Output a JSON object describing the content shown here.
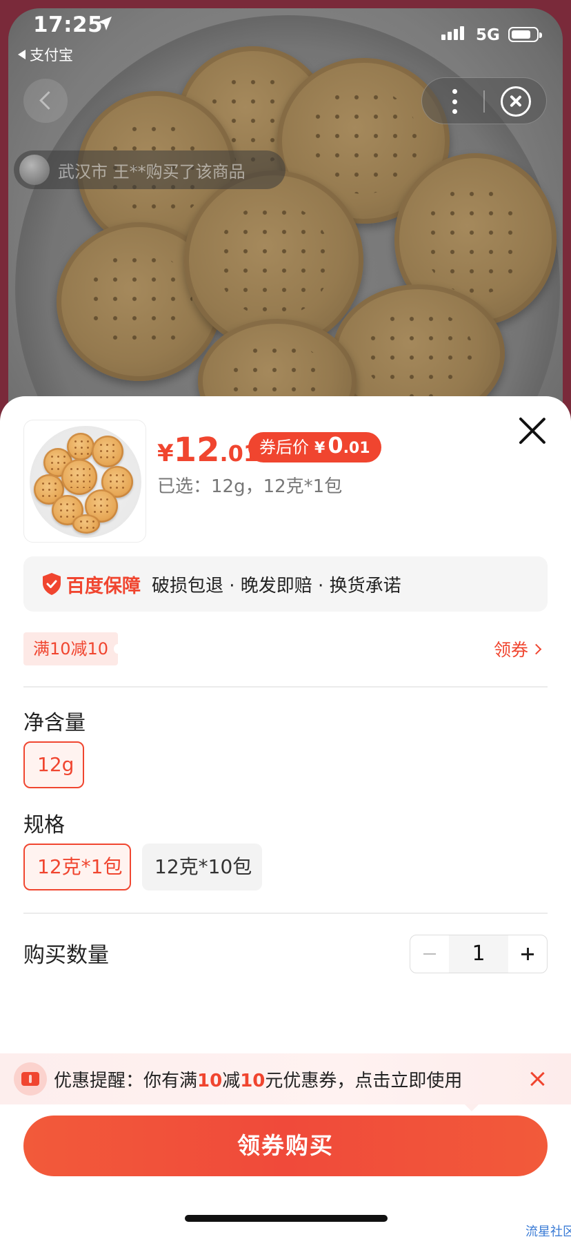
{
  "status_bar": {
    "time": "17:25",
    "back_app": "支付宝",
    "network": "5G"
  },
  "top_nav": {
    "back_icon": "chevron-left-icon",
    "more_icon": "more-vertical-icon",
    "close_icon": "circle-close-icon"
  },
  "buyer_toast": {
    "text": "武汉市 王**购买了该商品"
  },
  "sheet": {
    "price": {
      "currency": "¥",
      "integer": "12",
      "decimal": ".01"
    },
    "coupon_price": {
      "label": "券后价",
      "currency": "¥",
      "integer": "0",
      "decimal": ".01"
    },
    "selected": "已选：12g，12克*1包",
    "guarantee": {
      "brand": "百度保障",
      "items": "破损包退 · 晚发即赔 · 换货承诺"
    },
    "promo": {
      "tag": "满10减10",
      "action": "领券"
    },
    "net_content": {
      "title": "净含量",
      "options": [
        {
          "label": "12g",
          "selected": true
        }
      ]
    },
    "spec": {
      "title": "规格",
      "options": [
        {
          "label": "12克*1包",
          "selected": true
        },
        {
          "label": "12克*10包",
          "selected": false
        }
      ]
    },
    "quantity": {
      "label": "购买数量",
      "value": "1"
    },
    "reminder": {
      "prefix": "优惠提醒：你有满",
      "amount1": "10",
      "mid": "减",
      "amount2": "10",
      "suffix": "元优惠券，点击立即使用"
    },
    "buy_button": "领券购买"
  },
  "watermark": "流星社区",
  "colors": {
    "accent": "#f0452f",
    "accent_light": "#fde9e6",
    "backdrop": "#7a2a3a"
  }
}
